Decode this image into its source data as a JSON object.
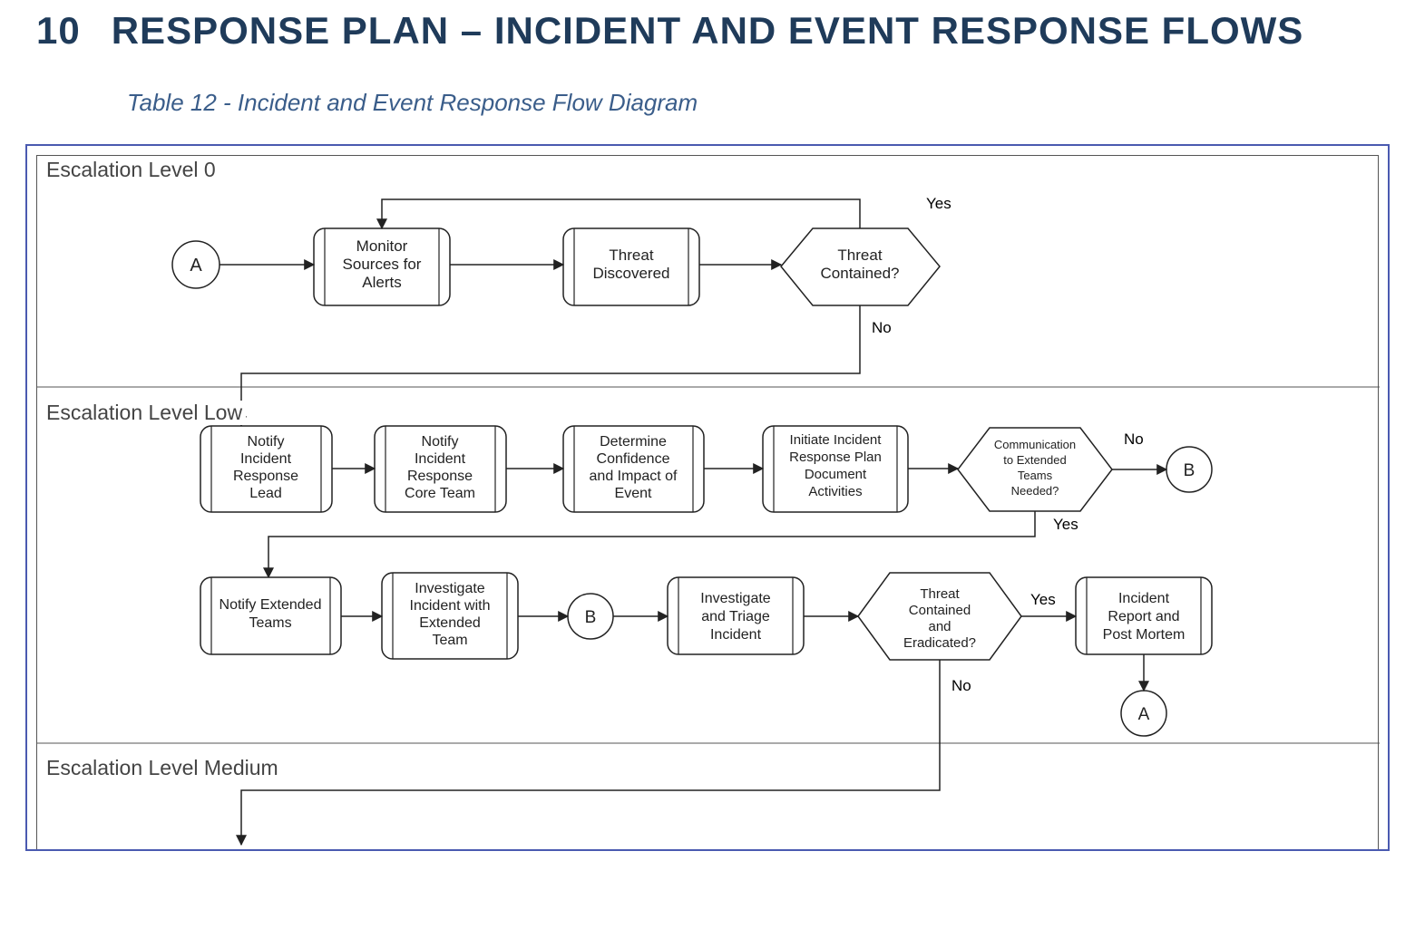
{
  "heading": {
    "number": "10",
    "title": "Response Plan – Incident and Event Response Flows"
  },
  "caption": "Table 12 - Incident and Event Response Flow Diagram",
  "sections": {
    "level0": "Escalation Level 0",
    "levelLow": "Escalation Level Low",
    "levelMedium": "Escalation Level Medium"
  },
  "nodes": {
    "A": "A",
    "monitorSources": "Monitor Sources for Alerts",
    "threatDiscovered": "Threat Discovered",
    "threatContained": "Threat Contained?",
    "notifyLead": "Notify Incident Response Lead",
    "notifyCore": "Notify Incident Response Core Team",
    "determineConf": "Determine Confidence and Impact of Event",
    "initiatePlan": "Initiate Incident Response Plan Document Activities",
    "commNeeded": "Communication to Extended Teams Needed?",
    "B": "B",
    "notifyExtended": "Notify Extended Teams",
    "investigateExtended": "Investigate Incident with Extended Team",
    "B2": "B",
    "investigateTriage": "Investigate and Triage Incident",
    "threatEradicated": "Threat Contained and Eradicated?",
    "incidentReport": "Incident Report and Post Mortem",
    "A2": "A"
  },
  "labels": {
    "yes": "Yes",
    "no": "No"
  },
  "chart_data": {
    "type": "flowchart",
    "title": "Incident and Event Response Flow Diagram",
    "swimlanes": [
      {
        "id": "level0",
        "name": "Escalation Level 0"
      },
      {
        "id": "levelLow",
        "name": "Escalation Level Low"
      },
      {
        "id": "levelMedium",
        "name": "Escalation Level Medium"
      }
    ],
    "nodes": [
      {
        "id": "A",
        "type": "connector",
        "label": "A",
        "lane": "level0"
      },
      {
        "id": "monitor",
        "type": "process",
        "label": "Monitor Sources for Alerts",
        "lane": "level0"
      },
      {
        "id": "discovered",
        "type": "process",
        "label": "Threat Discovered",
        "lane": "level0"
      },
      {
        "id": "contained",
        "type": "decision",
        "label": "Threat Contained?",
        "lane": "level0"
      },
      {
        "id": "notifyLead",
        "type": "process",
        "label": "Notify Incident Response Lead",
        "lane": "levelLow"
      },
      {
        "id": "notifyCore",
        "type": "process",
        "label": "Notify Incident Response Core Team",
        "lane": "levelLow"
      },
      {
        "id": "determine",
        "type": "process",
        "label": "Determine Confidence and Impact of Event",
        "lane": "levelLow"
      },
      {
        "id": "initiate",
        "type": "process",
        "label": "Initiate Incident Response Plan Document Activities",
        "lane": "levelLow"
      },
      {
        "id": "comm",
        "type": "decision",
        "label": "Communication to Extended Teams Needed?",
        "lane": "levelLow"
      },
      {
        "id": "B1",
        "type": "connector",
        "label": "B",
        "lane": "levelLow"
      },
      {
        "id": "notifyExt",
        "type": "process",
        "label": "Notify Extended Teams",
        "lane": "levelLow"
      },
      {
        "id": "investExt",
        "type": "process",
        "label": "Investigate Incident with Extended Team",
        "lane": "levelLow"
      },
      {
        "id": "B2",
        "type": "connector",
        "label": "B",
        "lane": "levelLow"
      },
      {
        "id": "triage",
        "type": "process",
        "label": "Investigate and Triage Incident",
        "lane": "levelLow"
      },
      {
        "id": "eradicated",
        "type": "decision",
        "label": "Threat Contained and Eradicated?",
        "lane": "levelLow"
      },
      {
        "id": "report",
        "type": "process",
        "label": "Incident Report and Post Mortem",
        "lane": "levelLow"
      },
      {
        "id": "A2",
        "type": "connector",
        "label": "A",
        "lane": "levelLow"
      }
    ],
    "edges": [
      {
        "from": "A",
        "to": "monitor"
      },
      {
        "from": "monitor",
        "to": "discovered"
      },
      {
        "from": "discovered",
        "to": "contained"
      },
      {
        "from": "contained",
        "to": "monitor",
        "label": "Yes"
      },
      {
        "from": "contained",
        "to": "notifyLead",
        "label": "No"
      },
      {
        "from": "notifyLead",
        "to": "notifyCore"
      },
      {
        "from": "notifyCore",
        "to": "determine"
      },
      {
        "from": "determine",
        "to": "initiate"
      },
      {
        "from": "initiate",
        "to": "comm"
      },
      {
        "from": "comm",
        "to": "B1",
        "label": "No"
      },
      {
        "from": "comm",
        "to": "notifyExt",
        "label": "Yes"
      },
      {
        "from": "notifyExt",
        "to": "investExt"
      },
      {
        "from": "investExt",
        "to": "B2"
      },
      {
        "from": "B2",
        "to": "triage"
      },
      {
        "from": "triage",
        "to": "eradicated"
      },
      {
        "from": "eradicated",
        "to": "report",
        "label": "Yes"
      },
      {
        "from": "eradicated",
        "to": "levelMedium",
        "label": "No"
      },
      {
        "from": "report",
        "to": "A2"
      }
    ]
  }
}
